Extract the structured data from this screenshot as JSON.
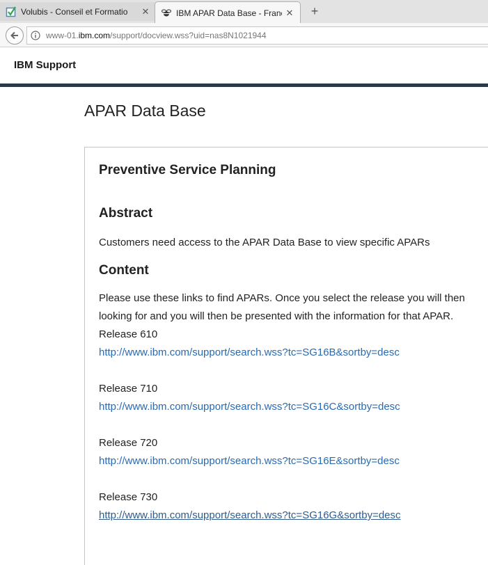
{
  "browser": {
    "tabs": [
      {
        "title": "Volubis - Conseil et Formatio",
        "active": false,
        "favicon": "check-box-icon"
      },
      {
        "title": "IBM APAR Data Base - France",
        "active": true,
        "favicon": "ibm-bee-icon"
      }
    ],
    "close_symbol": "✕",
    "new_tab_symbol": "+",
    "url_prefix": "www-01.",
    "url_domain": "ibm.com",
    "url_path": "/support/docview.wss?uid=nas8N1021944"
  },
  "header": {
    "brand": "IBM Support",
    "rule_color": "#2c3a48"
  },
  "page": {
    "title": "APAR Data Base",
    "doc_title": "Preventive Service Planning",
    "abstract_heading": "Abstract",
    "abstract_text": "Customers need access to the APAR Data Base to view specific APARs",
    "content_heading": "Content",
    "content_line1": "Please use these links to find APARs. Once you select the release you will then",
    "content_line2": "looking for and you will then be presented with the information for that APAR.",
    "link_color": "#2a6ab0",
    "releases": [
      {
        "label": "Release 610",
        "link": "http://www.ibm.com/support/search.wss?tc=SG16B&sortby=desc"
      },
      {
        "label": "Release 710",
        "link": "http://www.ibm.com/support/search.wss?tc=SG16C&sortby=desc"
      },
      {
        "label": "Release 720",
        "link": "http://www.ibm.com/support/search.wss?tc=SG16E&sortby=desc"
      },
      {
        "label": "Release 730",
        "link": "http://www.ibm.com/support/search.wss?tc=SG16G&sortby=desc"
      }
    ]
  }
}
